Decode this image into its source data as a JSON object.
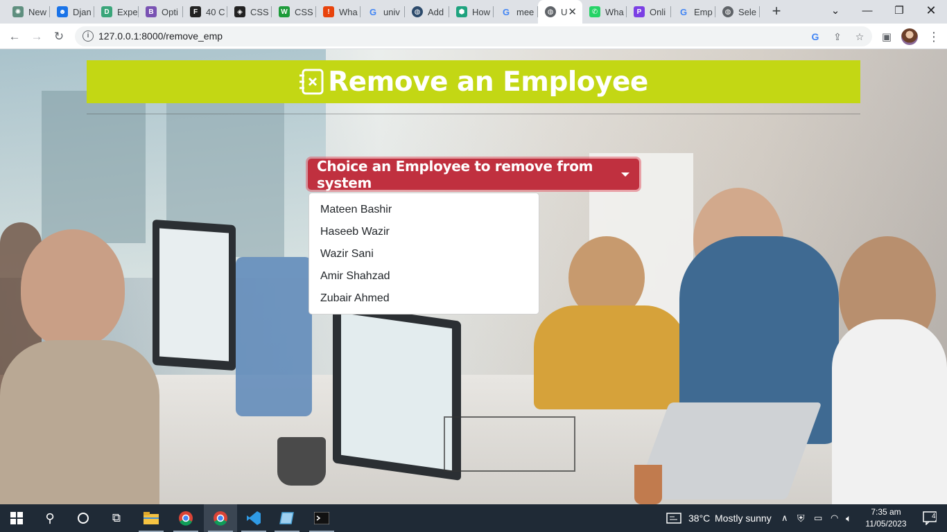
{
  "browser": {
    "tabs": [
      {
        "title": "New",
        "icon": "openai-icon",
        "color": "#5f8f7f"
      },
      {
        "title": "Djan",
        "icon": "contact-icon",
        "color": "#1a73e8"
      },
      {
        "title": "Expe",
        "icon": "d-icon",
        "color": "#3aa57a"
      },
      {
        "title": "Opti",
        "icon": "bootstrap-icon",
        "color": "#7952b3"
      },
      {
        "title": "40 C",
        "icon": "f-icon",
        "color": "#222222"
      },
      {
        "title": "CSS",
        "icon": "codepen-icon",
        "color": "#222222"
      },
      {
        "title": "CSS",
        "icon": "w-icon",
        "color": "#1d9b3a"
      },
      {
        "title": "Wha",
        "icon": "alert-icon",
        "color": "#e8430c"
      },
      {
        "title": "univ",
        "icon": "google-icon",
        "color": "#4285f4"
      },
      {
        "title": "Add",
        "icon": "globe-icon",
        "color": "#2c4a6b"
      },
      {
        "title": "How",
        "icon": "hexagon-icon",
        "color": "#1fa37f"
      },
      {
        "title": "mee",
        "icon": "google-icon",
        "color": "#4285f4"
      },
      {
        "title": "U",
        "icon": "globe-icon",
        "color": "#5f6368"
      },
      {
        "title": "Wha",
        "icon": "whatsapp-icon",
        "color": "#25d366"
      },
      {
        "title": "Onli",
        "icon": "p-icon",
        "color": "#7b3fe4"
      },
      {
        "title": "Emp",
        "icon": "google-icon",
        "color": "#4285f4"
      },
      {
        "title": "Sele",
        "icon": "globe-icon",
        "color": "#5f6368"
      }
    ],
    "active_tab_index": 12,
    "url": "127.0.0.1:8000/remove_emp"
  },
  "page": {
    "title": "Remove an Employee",
    "dropdown": {
      "label": "Choice an Employee to remove from system",
      "items": [
        "Mateen Bashir",
        "Haseeb Wazir",
        "Wazir Sani",
        "Amir Shahzad",
        "Zubair Ahmed"
      ]
    },
    "colors": {
      "banner": "#c3d714",
      "button": "#c0303f"
    }
  },
  "taskbar": {
    "weather": {
      "temp": "38°C",
      "condition": "Mostly sunny"
    },
    "time": "7:35 am",
    "date": "11/05/2023",
    "notifications": "4"
  }
}
